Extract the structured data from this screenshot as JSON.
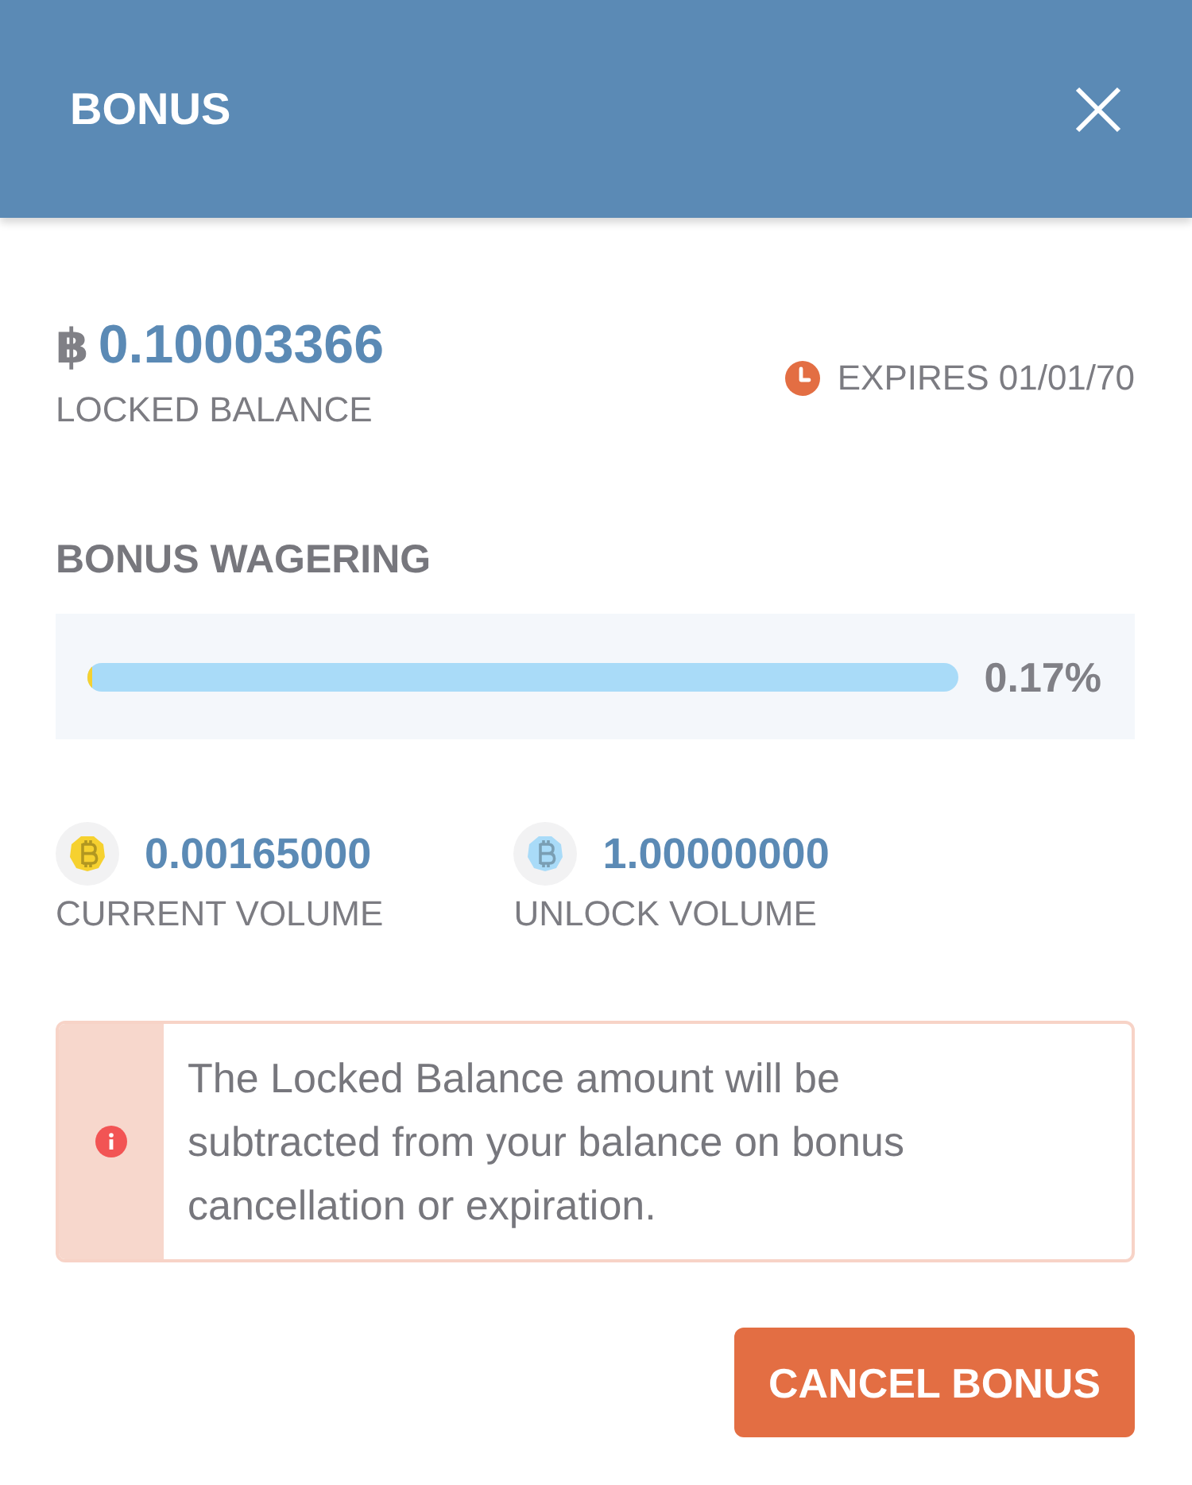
{
  "dialog": {
    "title": "BONUS"
  },
  "balance": {
    "currency_symbol": "฿",
    "amount": "0.10003366",
    "label": "LOCKED BALANCE"
  },
  "expiry": {
    "text": "EXPIRES 01/01/70"
  },
  "wagering": {
    "heading": "BONUS WAGERING",
    "level": 0.0017,
    "reading": "0.17%"
  },
  "volumes": [
    {
      "amount": "0.00165000",
      "label": "CURRENT VOLUME",
      "color": "#f6d12f"
    },
    {
      "amount": "1.00000000",
      "label": "UNLOCK VOLUME",
      "color": "#a9dbf8"
    }
  ],
  "notice": {
    "text": "The Locked Balance amount will be subtracted from your balance on bonus cancellation or expiration."
  },
  "button": {
    "label": "CANCEL BONUS"
  }
}
